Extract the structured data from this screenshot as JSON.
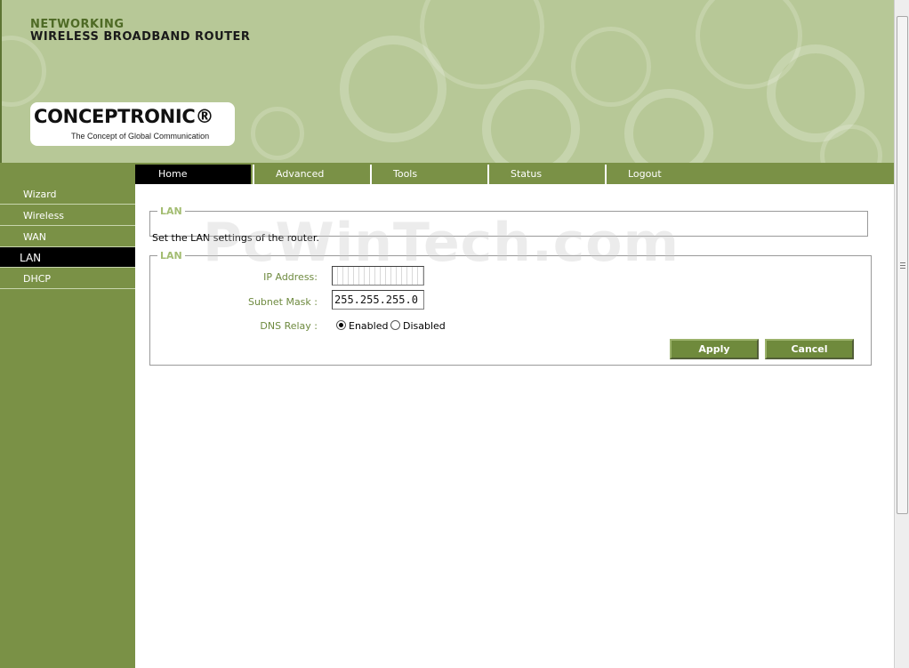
{
  "header": {
    "line1": "NETWORKING",
    "line2": "WIRELESS BROADBAND ROUTER",
    "logo_text": "CONCEPTRONIC®",
    "logo_tagline": "The Concept of Global Communication"
  },
  "topnav": {
    "tabs": [
      {
        "label": "Home",
        "active": true
      },
      {
        "label": "Advanced"
      },
      {
        "label": "Tools"
      },
      {
        "label": "Status"
      },
      {
        "label": "Logout"
      }
    ]
  },
  "sidebar": {
    "items": [
      {
        "label": "Wizard"
      },
      {
        "label": "Wireless"
      },
      {
        "label": "WAN"
      },
      {
        "label": "LAN",
        "active": true
      },
      {
        "label": "DHCP"
      }
    ]
  },
  "info_box": {
    "legend": "LAN",
    "description": "Set the LAN settings of the router."
  },
  "form": {
    "legend": "LAN",
    "ip_label": "IP Address:",
    "ip_value": "",
    "subnet_label": "Subnet Mask :",
    "subnet_value": "255.255.255.0",
    "dns_label": "DNS Relay :",
    "dns_enabled": "Enabled",
    "dns_disabled": "Disabled",
    "dns_selected": "Enabled",
    "apply": "Apply",
    "cancel": "Cancel"
  },
  "watermark": "PcWinTech.com",
  "colors": {
    "nav_green": "#7a9146",
    "header_green": "#b7c897",
    "legend_green": "#a3bd72",
    "label_green": "#6e8a3f"
  }
}
